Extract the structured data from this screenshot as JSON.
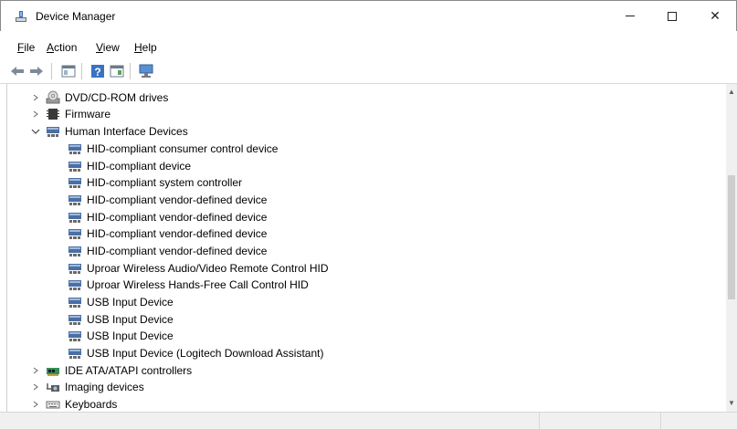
{
  "window": {
    "title": "Device Manager",
    "controls": {
      "minimize": "minimize",
      "maximize": "maximize",
      "close": "✕"
    }
  },
  "menu": [
    {
      "prefix": "",
      "underlined": "F",
      "rest": "ile"
    },
    {
      "prefix": "",
      "underlined": "A",
      "rest": "ction"
    },
    {
      "prefix": "",
      "underlined": "V",
      "rest": "iew"
    },
    {
      "prefix": "",
      "underlined": "H",
      "rest": "elp"
    }
  ],
  "toolbar": {
    "icons": [
      "back-icon",
      "forward-icon",
      "show-hide-console-tree-icon",
      "help-icon",
      "properties-pane-icon",
      "scan-hardware-icon"
    ]
  },
  "tree": {
    "items": [
      {
        "label": "DVD/CD-ROM drives",
        "level": 1,
        "expander": "collapsed",
        "icon": "dvd-drive-icon"
      },
      {
        "label": "Firmware",
        "level": 1,
        "expander": "collapsed",
        "icon": "firmware-icon"
      },
      {
        "label": "Human Interface Devices",
        "level": 1,
        "expander": "expanded",
        "icon": "hid-icon"
      },
      {
        "label": "HID-compliant consumer control device",
        "level": 2,
        "icon": "hid-icon"
      },
      {
        "label": "HID-compliant device",
        "level": 2,
        "icon": "hid-icon"
      },
      {
        "label": "HID-compliant system controller",
        "level": 2,
        "icon": "hid-icon"
      },
      {
        "label": "HID-compliant vendor-defined device",
        "level": 2,
        "icon": "hid-icon"
      },
      {
        "label": "HID-compliant vendor-defined device",
        "level": 2,
        "icon": "hid-icon"
      },
      {
        "label": "HID-compliant vendor-defined device",
        "level": 2,
        "icon": "hid-icon"
      },
      {
        "label": "HID-compliant vendor-defined device",
        "level": 2,
        "icon": "hid-icon"
      },
      {
        "label": "Uproar Wireless Audio/Video Remote Control HID",
        "level": 2,
        "icon": "hid-icon"
      },
      {
        "label": "Uproar Wireless Hands-Free Call Control HID",
        "level": 2,
        "icon": "hid-icon"
      },
      {
        "label": "USB Input Device",
        "level": 2,
        "icon": "hid-icon"
      },
      {
        "label": "USB Input Device",
        "level": 2,
        "icon": "hid-icon"
      },
      {
        "label": "USB Input Device",
        "level": 2,
        "icon": "hid-icon"
      },
      {
        "label": "USB Input Device (Logitech Download Assistant)",
        "level": 2,
        "icon": "hid-icon"
      },
      {
        "label": "IDE ATA/ATAPI controllers",
        "level": 1,
        "expander": "collapsed",
        "icon": "ide-controller-icon"
      },
      {
        "label": "Imaging devices",
        "level": 1,
        "expander": "collapsed",
        "icon": "imaging-device-icon"
      },
      {
        "label": "Keyboards",
        "level": 1,
        "expander": "collapsed",
        "icon": "keyboard-icon"
      }
    ]
  },
  "colors": {
    "window_bg": "#ffffff",
    "statusbar_bg": "#f0f0f0",
    "scroll_thumb": "#cdcdcd",
    "hid_icon_blue": "#4a6fa5"
  }
}
